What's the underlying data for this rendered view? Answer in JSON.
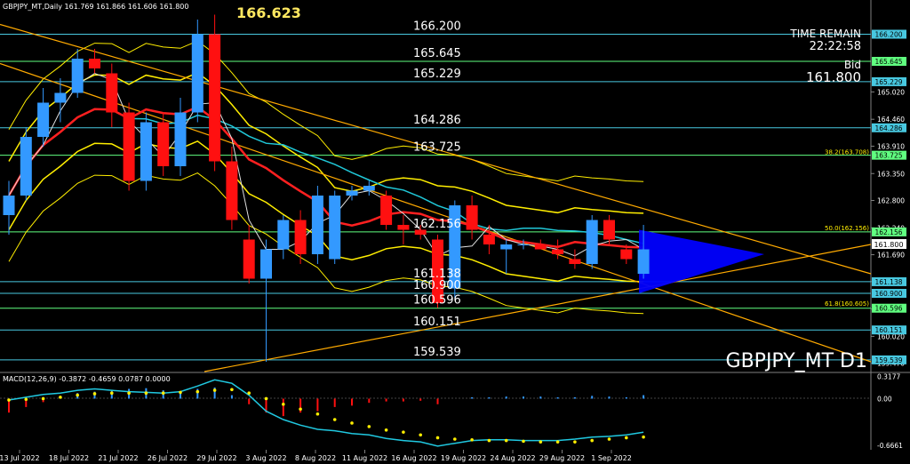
{
  "header": {
    "symbol_info": "GBPJPY_MT,Daily  161.769 161.866 161.606 161.800",
    "macd_info": "MACD(12,26,9) -0.3872 -0.4659 0.0787 0.0000",
    "symbol_tf": "GBPJPY_MT D1",
    "high_label": "166.623"
  },
  "info": {
    "time_remain_label": "TIME REMAIN",
    "time_remain": "22:22:58",
    "bid_label": "Bid",
    "bid": "161.800"
  },
  "levels": [
    {
      "value": "166.200",
      "color": "#48c8e0"
    },
    {
      "value": "165.645",
      "color": "#60ff80"
    },
    {
      "value": "165.229",
      "color": "#48c8e0"
    },
    {
      "value": "164.286",
      "color": "#48c8e0"
    },
    {
      "value": "163.725",
      "color": "#60ff80"
    },
    {
      "value": "162.156",
      "color": "#60ff80"
    },
    {
      "value": "161.138",
      "color": "#48c8e0"
    },
    {
      "value": "160.900",
      "color": "#48c8e0"
    },
    {
      "value": "160.596",
      "color": "#60ff80"
    },
    {
      "value": "160.151",
      "color": "#48c8e0"
    },
    {
      "value": "159.539",
      "color": "#48c8e0"
    }
  ],
  "fib_labels": [
    "38.2(163.708)",
    "50.0(162.156)",
    "61.8(160.605)"
  ],
  "price_axis": [
    "165.020",
    "164.460",
    "163.910",
    "163.350",
    "162.800",
    "162.240",
    "161.690",
    "161.140",
    "160.580",
    "160.020",
    "159.470"
  ],
  "macd_axis": [
    "0.3177",
    "0.00",
    "-0.6661"
  ],
  "colors": {
    "up": "#3399ff",
    "down": "#ff1010",
    "level_cyan": "#48c8e0",
    "level_green": "#60ff80",
    "envelope": "#ffee00",
    "trend": "#ffaa00",
    "ma_red": "#ff2020",
    "ma_cyan": "#20c8d8",
    "ma_white": "#e0e0e0",
    "triangle": "#0000ff",
    "macd_line": "#20c8e0",
    "macd_signal": "#ffee00"
  },
  "chart_data": {
    "type": "candlestick",
    "symbol": "GBPJPY_MT",
    "timeframe": "D1",
    "x_labels": [
      "13 Jul 2022",
      "18 Jul 2022",
      "21 Jul 2022",
      "26 Jul 2022",
      "29 Jul 2022",
      "3 Aug 2022",
      "8 Aug 2022",
      "11 Aug 2022",
      "16 Aug 2022",
      "19 Aug 2022",
      "24 Aug 2022",
      "29 Aug 2022",
      "1 Sep 2022"
    ],
    "y_range": [
      159.3,
      166.9
    ],
    "candles": [
      {
        "o": 162.5,
        "h": 163.2,
        "l": 162.1,
        "c": 162.9
      },
      {
        "o": 162.9,
        "h": 164.3,
        "l": 162.8,
        "c": 164.1
      },
      {
        "o": 164.1,
        "h": 165.1,
        "l": 163.9,
        "c": 164.8
      },
      {
        "o": 164.8,
        "h": 165.3,
        "l": 164.4,
        "c": 165.0
      },
      {
        "o": 165.0,
        "h": 165.9,
        "l": 164.9,
        "c": 165.7
      },
      {
        "o": 165.7,
        "h": 165.9,
        "l": 165.4,
        "c": 165.5
      },
      {
        "o": 165.4,
        "h": 165.6,
        "l": 164.3,
        "c": 164.6
      },
      {
        "o": 164.6,
        "h": 164.8,
        "l": 163.0,
        "c": 163.2
      },
      {
        "o": 163.2,
        "h": 164.6,
        "l": 163.0,
        "c": 164.4
      },
      {
        "o": 164.4,
        "h": 164.6,
        "l": 163.3,
        "c": 163.5
      },
      {
        "o": 163.5,
        "h": 164.9,
        "l": 163.3,
        "c": 164.6
      },
      {
        "o": 164.6,
        "h": 166.5,
        "l": 164.4,
        "c": 166.2
      },
      {
        "o": 166.2,
        "h": 166.6,
        "l": 163.4,
        "c": 163.6
      },
      {
        "o": 163.6,
        "h": 163.9,
        "l": 162.2,
        "c": 162.4
      },
      {
        "o": 162.0,
        "h": 162.3,
        "l": 161.1,
        "c": 161.2
      },
      {
        "o": 161.2,
        "h": 162.0,
        "l": 159.5,
        "c": 161.8
      },
      {
        "o": 161.8,
        "h": 162.5,
        "l": 161.6,
        "c": 162.4
      },
      {
        "o": 162.4,
        "h": 162.6,
        "l": 161.5,
        "c": 161.7
      },
      {
        "o": 161.7,
        "h": 163.1,
        "l": 161.5,
        "c": 162.9
      },
      {
        "o": 161.6,
        "h": 163.0,
        "l": 161.5,
        "c": 162.9
      },
      {
        "o": 162.9,
        "h": 163.1,
        "l": 162.8,
        "c": 163.0
      },
      {
        "o": 163.0,
        "h": 163.2,
        "l": 162.9,
        "c": 163.1
      },
      {
        "o": 162.9,
        "h": 163.0,
        "l": 162.2,
        "c": 162.3
      },
      {
        "o": 162.3,
        "h": 162.5,
        "l": 161.9,
        "c": 162.2
      },
      {
        "o": 162.2,
        "h": 162.3,
        "l": 162.0,
        "c": 162.1
      },
      {
        "o": 162.0,
        "h": 162.1,
        "l": 160.6,
        "c": 160.7
      },
      {
        "o": 161.0,
        "h": 162.8,
        "l": 160.8,
        "c": 162.7
      },
      {
        "o": 162.7,
        "h": 162.9,
        "l": 162.0,
        "c": 162.2
      },
      {
        "o": 162.1,
        "h": 162.3,
        "l": 161.7,
        "c": 161.9
      },
      {
        "o": 161.8,
        "h": 162.0,
        "l": 161.3,
        "c": 161.9
      },
      {
        "o": 161.9,
        "h": 162.0,
        "l": 161.8,
        "c": 161.9
      },
      {
        "o": 161.9,
        "h": 162.0,
        "l": 161.8,
        "c": 161.8
      },
      {
        "o": 161.8,
        "h": 162.0,
        "l": 161.6,
        "c": 161.7
      },
      {
        "o": 161.6,
        "h": 161.8,
        "l": 161.4,
        "c": 161.5
      },
      {
        "o": 161.5,
        "h": 162.5,
        "l": 161.4,
        "c": 162.4
      },
      {
        "o": 162.4,
        "h": 162.5,
        "l": 161.9,
        "c": 162.0
      },
      {
        "o": 161.8,
        "h": 161.9,
        "l": 161.5,
        "c": 161.6
      },
      {
        "o": 161.3,
        "h": 162.3,
        "l": 161.2,
        "c": 161.8
      }
    ],
    "macd_range": [
      -0.72,
      0.35
    ],
    "macd_hist": [
      -0.2,
      -0.12,
      -0.05,
      0.0,
      0.08,
      0.1,
      0.12,
      0.14,
      0.15,
      0.12,
      0.1,
      0.14,
      0.16,
      0.05,
      -0.08,
      -0.2,
      -0.25,
      -0.2,
      -0.18,
      -0.12,
      -0.1,
      -0.06,
      -0.04,
      -0.04,
      -0.03,
      -0.08,
      0.0,
      0.02,
      0.02,
      0.03,
      0.03,
      0.03,
      0.02,
      0.02,
      0.04,
      0.03,
      0.02,
      0.05
    ],
    "macd_line": [
      -0.02,
      0.02,
      0.06,
      0.08,
      0.12,
      0.14,
      0.12,
      0.1,
      0.09,
      0.08,
      0.1,
      0.18,
      0.27,
      0.22,
      0.05,
      -0.18,
      -0.3,
      -0.38,
      -0.44,
      -0.46,
      -0.5,
      -0.52,
      -0.57,
      -0.6,
      -0.62,
      -0.68,
      -0.64,
      -0.6,
      -0.59,
      -0.59,
      -0.6,
      -0.6,
      -0.6,
      -0.58,
      -0.55,
      -0.54,
      -0.52,
      -0.48
    ],
    "macd_signal": [
      -0.02,
      -0.01,
      0.0,
      0.02,
      0.05,
      0.07,
      0.08,
      0.08,
      0.08,
      0.08,
      0.09,
      0.1,
      0.12,
      0.13,
      0.08,
      0.0,
      -0.08,
      -0.15,
      -0.22,
      -0.3,
      -0.35,
      -0.4,
      -0.45,
      -0.48,
      -0.52,
      -0.56,
      -0.58,
      -0.59,
      -0.6,
      -0.6,
      -0.61,
      -0.62,
      -0.62,
      -0.62,
      -0.6,
      -0.58,
      -0.56,
      -0.55
    ]
  }
}
